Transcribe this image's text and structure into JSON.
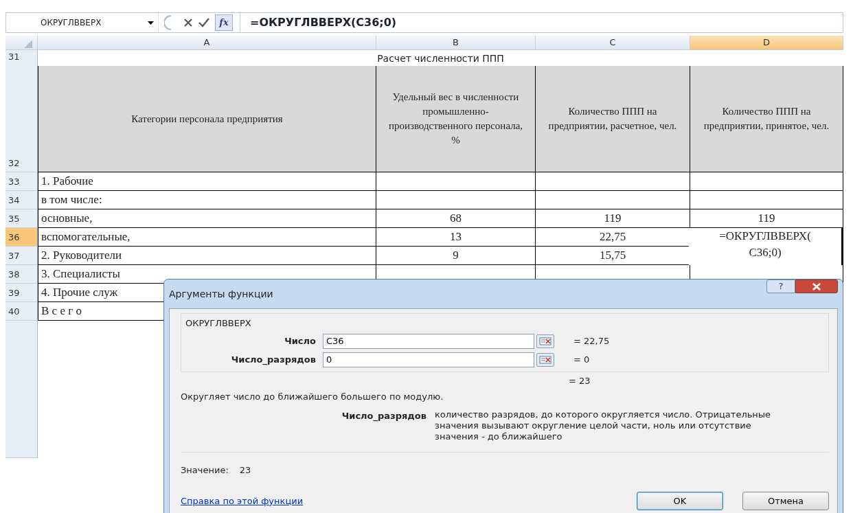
{
  "formula_bar": {
    "name_box": "ОКРУГЛВВЕРХ",
    "function_button": "fx",
    "formula": "=ОКРУГЛВВЕРХ(C36;0)"
  },
  "columns": [
    {
      "label": "A",
      "selected": false
    },
    {
      "label": "B",
      "selected": false
    },
    {
      "label": "C",
      "selected": false
    },
    {
      "label": "D",
      "selected": true
    }
  ],
  "sheet": {
    "title_row": {
      "number": "31",
      "selected": false,
      "text": "Расчет численности ППП"
    },
    "header_row": {
      "number": "32",
      "selected": false,
      "cells": [
        "Категории персонала предприятия",
        "Удельный вес в численности промышленно-производственного персонала, %",
        "Количество ППП на предприятии, расчетное, чел.",
        "Количество ППП на предприятии, принятое, чел."
      ]
    },
    "rows": [
      {
        "number": "33",
        "selected": false,
        "a": "1. Рабочие"
      },
      {
        "number": "34",
        "selected": false,
        "a": "в том числе:"
      },
      {
        "number": "35",
        "selected": false,
        "a": "основные,",
        "b": "68",
        "c": "119",
        "d": "119"
      },
      {
        "number": "36",
        "selected": true,
        "a": "вспомогательные,",
        "b": "13",
        "c": "22,75",
        "editing": true,
        "edit_lines": [
          "=ОКРУГЛВВЕРХ(",
          "C36;0)"
        ]
      },
      {
        "number": "37",
        "selected": false,
        "a": "2. Руководители",
        "b": "9",
        "c": "15,75"
      },
      {
        "number": "38",
        "selected": false,
        "a": "3. Специалисты"
      },
      {
        "number": "39",
        "selected": false,
        "a": "4. Прочие служ"
      },
      {
        "number": "40",
        "selected": false,
        "a": "В с е г о"
      }
    ]
  },
  "dialog": {
    "title": "Аргументы функции",
    "help_button": "?",
    "function_name": "ОКРУГЛВВЕРХ",
    "arguments": [
      {
        "label": "Число",
        "value": "C36",
        "result": "= 22,75"
      },
      {
        "label": "Число_разрядов",
        "value": "0",
        "result": "= 0"
      }
    ],
    "formula_result": "= 23",
    "description": "Округляет число до ближайшего большего по модулю.",
    "argument_help": {
      "label": "Число_разрядов",
      "text": "количество разрядов, до которого округляется число. Отрицательные значения вызывают округление целой части, ноль или отсутствие значения - до ближайшего"
    },
    "value_label": "Значение:",
    "value": "23",
    "help_link": "Справка по этой функции",
    "buttons": [
      {
        "label": "OK",
        "default": true
      },
      {
        "label": "Отмена",
        "default": false
      }
    ]
  }
}
